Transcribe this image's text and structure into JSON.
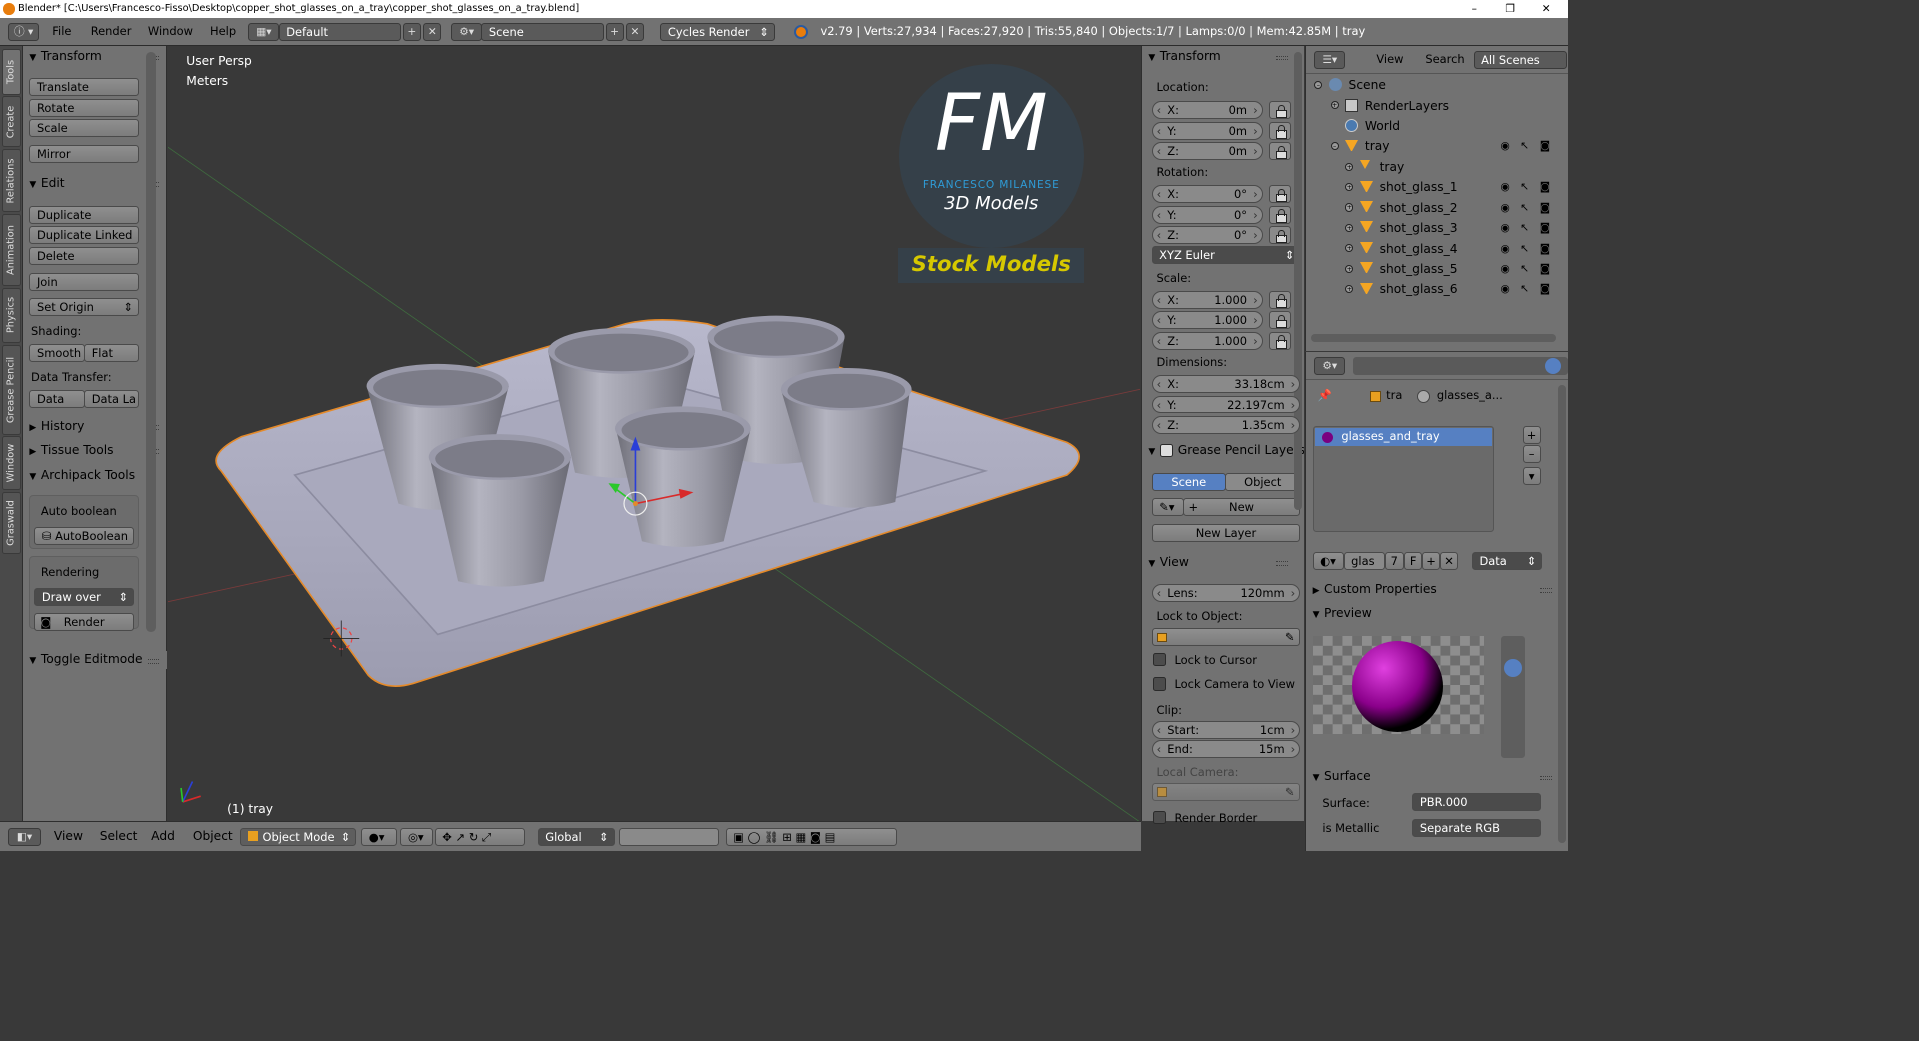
{
  "window": {
    "title": "Blender* [C:\\Users\\Francesco-Fisso\\Desktop\\copper_shot_glasses_on_a_tray\\copper_shot_glasses_on_a_tray.blend]",
    "minimize": "–",
    "maximize": "❐",
    "close": "✕"
  },
  "infobar": {
    "menus": [
      "File",
      "Render",
      "Window",
      "Help"
    ],
    "layout": "Default",
    "scene": "Scene",
    "engine": "Cycles Render",
    "stats": "v2.79 | Verts:27,934 | Faces:27,920 | Tris:55,840 | Objects:1/7 | Lamps:0/0 | Mem:42.85M | tray"
  },
  "tabs": [
    "Tools",
    "Create",
    "Relations",
    "Animation",
    "Physics",
    "Grease Pencil",
    "Window",
    "Graswald"
  ],
  "toolshelf": {
    "transform": {
      "title": "Transform",
      "buttons": [
        "Translate",
        "Rotate",
        "Scale",
        "Mirror"
      ]
    },
    "edit": {
      "title": "Edit",
      "buttons": [
        "Duplicate",
        "Duplicate Linked",
        "Delete",
        "Join"
      ],
      "set_origin": "Set Origin",
      "shading_label": "Shading:",
      "smooth": "Smooth",
      "flat": "Flat",
      "data_transfer_label": "Data Transfer:",
      "data": "Data",
      "data_layout": "Data La"
    },
    "history": "History",
    "tissue": "Tissue Tools",
    "archipack": {
      "title": "Archipack Tools",
      "auto_boolean_label": "Auto boolean",
      "auto_boolean_btn": "AutoBoolean",
      "rendering_label": "Rendering",
      "draw_over": "Draw over",
      "render": "Render"
    },
    "toggle_editmode": "Toggle Editmode"
  },
  "viewport": {
    "view_name": "User Persp",
    "units": "Meters",
    "object_label": "(1) tray",
    "logo": {
      "letters": "FM",
      "brand": "FRANCESCO MILANESE",
      "subtitle": "3D Models",
      "tagline": "Stock Models"
    }
  },
  "npanel": {
    "transform_title": "Transform",
    "location_label": "Location:",
    "location": [
      {
        "k": "X:",
        "v": "0m"
      },
      {
        "k": "Y:",
        "v": "0m"
      },
      {
        "k": "Z:",
        "v": "0m"
      }
    ],
    "rotation_label": "Rotation:",
    "rotation": [
      {
        "k": "X:",
        "v": "0°"
      },
      {
        "k": "Y:",
        "v": "0°"
      },
      {
        "k": "Z:",
        "v": "0°"
      }
    ],
    "rotation_mode": "XYZ Euler",
    "scale_label": "Scale:",
    "scale": [
      {
        "k": "X:",
        "v": "1.000"
      },
      {
        "k": "Y:",
        "v": "1.000"
      },
      {
        "k": "Z:",
        "v": "1.000"
      }
    ],
    "dimensions_label": "Dimensions:",
    "dimensions": [
      {
        "k": "X:",
        "v": "33.18cm"
      },
      {
        "k": "Y:",
        "v": "22.197cm"
      },
      {
        "k": "Z:",
        "v": "1.35cm"
      }
    ],
    "grease_title": "Grease Pencil Layers",
    "scene_tab": "Scene",
    "object_tab": "Object",
    "new": "New",
    "new_layer": "New Layer",
    "view_title": "View",
    "lens_k": "Lens:",
    "lens_v": "120mm",
    "lock_object_label": "Lock to Object:",
    "lock_cursor": "Lock to Cursor",
    "lock_camera": "Lock Camera to View",
    "clip_label": "Clip:",
    "clip_start_k": "Start:",
    "clip_start_v": "1cm",
    "clip_end_k": "End:",
    "clip_end_v": "15m",
    "local_camera": "Local Camera:",
    "render_border": "Render Border"
  },
  "outliner": {
    "view": "View",
    "search": "Search",
    "all_scenes": "All Scenes",
    "rows": [
      {
        "label": "Scene",
        "indent": 0
      },
      {
        "label": "RenderLayers",
        "indent": 1
      },
      {
        "label": "World",
        "indent": 1
      },
      {
        "label": "tray",
        "indent": 1
      },
      {
        "label": "tray",
        "indent": 2
      },
      {
        "label": "shot_glass_1",
        "indent": 2
      },
      {
        "label": "shot_glass_2",
        "indent": 2
      },
      {
        "label": "shot_glass_3",
        "indent": 2
      },
      {
        "label": "shot_glass_4",
        "indent": 2
      },
      {
        "label": "shot_glass_5",
        "indent": 2
      },
      {
        "label": "shot_glass_6",
        "indent": 2
      }
    ]
  },
  "properties": {
    "breadcrumb_obj": "tra",
    "breadcrumb_mat": "glasses_a...",
    "material_slot": "glasses_and_tray",
    "mat_name": "glas",
    "users": "7",
    "fake": "F",
    "link": "Data",
    "custom_props": "Custom Properties",
    "preview": "Preview",
    "surface_title": "Surface",
    "surface_label": "Surface:",
    "surface_value": "PBR.000",
    "metallic_label": "is Metallic",
    "metallic_value": "Separate RGB"
  },
  "bottombar": {
    "menus": [
      "View",
      "Select",
      "Add",
      "Object"
    ],
    "mode": "Object Mode",
    "orientation": "Global"
  },
  "colors": {
    "panel": "#727272",
    "viewport": "#393939",
    "selected": "#5680c2",
    "logo_blue": "#2f9bd6",
    "logo_yellow": "#d6c800"
  }
}
